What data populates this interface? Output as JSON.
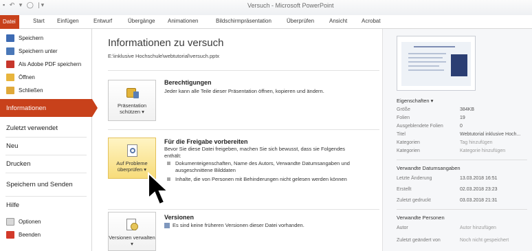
{
  "window": {
    "title": "Versuch - Microsoft PowerPoint",
    "qat": "▪ ↶ ▾ ◯ |▾"
  },
  "tabs": [
    {
      "label": "Datei"
    },
    {
      "label": "Start"
    },
    {
      "label": "Einfügen"
    },
    {
      "label": "Entwurf"
    },
    {
      "label": "Übergänge"
    },
    {
      "label": "Animationen"
    },
    {
      "label": "Bildschirmpräsentation"
    },
    {
      "label": "Überprüfen"
    },
    {
      "label": "Ansicht"
    },
    {
      "label": "Acrobat"
    }
  ],
  "nav": {
    "save": "Speichern",
    "save_as": "Speichern unter",
    "save_pdf": "Als Adobe PDF speichern",
    "open": "Öffnen",
    "close": "Schließen",
    "info": "Informationen",
    "recent": "Zuletzt verwendet",
    "new": "Neu",
    "print": "Drucken",
    "save_send": "Speichern und Senden",
    "help": "Hilfe",
    "options": "Optionen",
    "exit": "Beenden"
  },
  "main": {
    "title": "Informationen zu versuch",
    "path": "E:\\inklusive Hochschule\\webtutorial\\versuch.pptx",
    "permissions": {
      "tile_label": "Präsentation schützen ▾",
      "heading": "Berechtigungen",
      "text": "Jeder kann alle Teile dieser Präsentation öffnen, kopieren und ändern."
    },
    "prepare": {
      "tile_label": "Auf Probleme überprüfen ▾",
      "heading": "Für die Freigabe vorbereiten",
      "text": "Bevor Sie diese Datei freigeben, machen Sie sich bewusst, dass sie Folgendes enthält:",
      "bullets": [
        "Dokumenteigenschaften, Name des Autors, Verwandte Datumsangaben und ausgeschnittene Bilddaten",
        "Inhalte, die von Personen mit Behinderungen nicht gelesen werden können"
      ]
    },
    "versions": {
      "tile_label": "Versionen verwalten ▾",
      "heading": "Versionen",
      "text": "Es sind keine früheren Versionen dieser Datei vorhanden."
    }
  },
  "properties": {
    "heading": "Eigenschaften ▾",
    "rows": [
      {
        "label": "Größe",
        "value": "384KB"
      },
      {
        "label": "Folien",
        "value": "19"
      },
      {
        "label": "Ausgeblendete Folien",
        "value": "0"
      },
      {
        "label": "Titel",
        "value": "Webtutorial inklusive Hoch..."
      },
      {
        "label": "Kategorien",
        "value": "Tag hinzufügen"
      },
      {
        "label": "Kategorien",
        "value": "Kategorie hinzufügen"
      }
    ],
    "dates_heading": "Verwandte Datumsangaben",
    "dates": [
      {
        "label": "Letzte Änderung",
        "value": "13.03.2018 16:51"
      },
      {
        "label": "Erstellt",
        "value": "02.03.2018 23:23"
      },
      {
        "label": "Zuletzt gedruckt",
        "value": "03.03.2018 21:31"
      }
    ],
    "people_heading": "Verwandte Personen",
    "people": [
      {
        "label": "Autor",
        "value": "Autor hinzufügen"
      },
      {
        "label": "Zuletzt geändert von",
        "value": "Noch nicht gespeichert"
      }
    ]
  },
  "colors": {
    "accent": "#c8411b",
    "highlight": "#f7dc7a"
  }
}
